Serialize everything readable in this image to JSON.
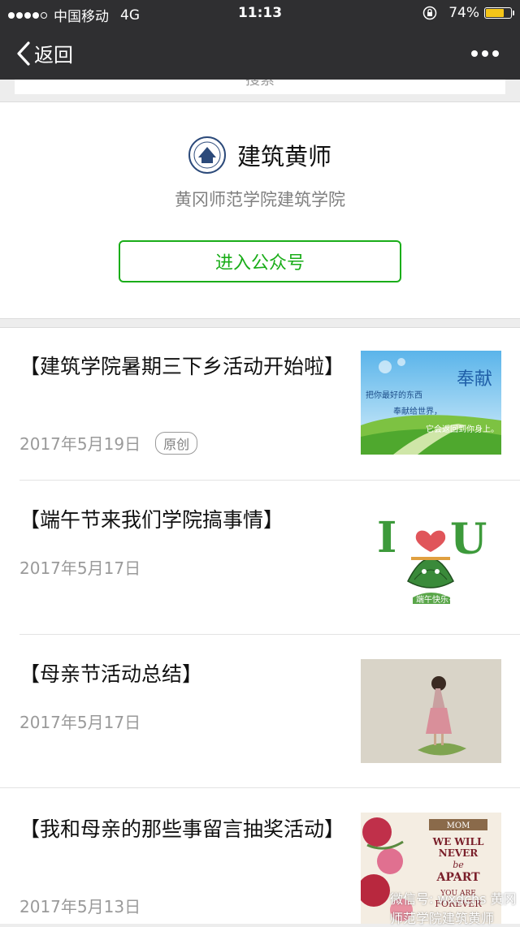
{
  "status_bar": {
    "carrier": "中国移动",
    "network": "4G",
    "time": "11:13",
    "battery_text": "74%",
    "battery_level": 0.74,
    "signal_bars_filled": 4,
    "signal_bars_total": 5
  },
  "nav": {
    "back_label": "返回"
  },
  "search": {
    "label": "搜索"
  },
  "account": {
    "name": "建筑黄师",
    "description": "黄冈师范学院建筑学院",
    "enter_label": "进入公众号"
  },
  "articles": [
    {
      "title": "【建筑学院暑期三下乡活动开始啦】",
      "date": "2017年5月19日",
      "badge": "原创",
      "thumb_text": {
        "big": "奉献",
        "line1": "把你最好的东西",
        "line2": "奉献给世界，",
        "line3": "它会返回到你身上。"
      }
    },
    {
      "title": "【端午节来我们学院搞事情】",
      "date": "2017年5月17日",
      "badge": "",
      "thumb_text": {
        "line1": "I",
        "line2": "U",
        "caption": "端午快乐~"
      }
    },
    {
      "title": "【母亲节活动总结】",
      "date": "2017年5月17日",
      "badge": ""
    },
    {
      "title": "【我和母亲的那些事留言抽奖活动】",
      "date": "2017年5月13日",
      "badge": "",
      "thumb_text": {
        "line1": "MOM",
        "line2": "WE WILL",
        "line3": "NEVER",
        "line4": "be",
        "line5": "APART",
        "line6": "YOU ARE",
        "line7": "FOREVER"
      }
    }
  ],
  "watermark": "微信号: wxdchs 黄冈师范学院建筑黄师"
}
